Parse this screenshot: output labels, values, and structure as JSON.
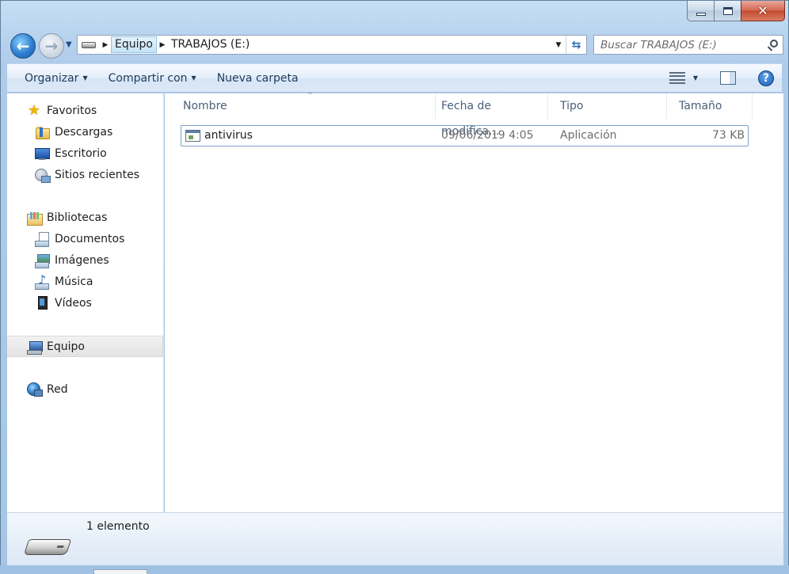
{
  "window": {
    "close_label": "✕"
  },
  "navigation": {
    "back_glyph": "←",
    "forward_glyph": "→",
    "breadcrumb": [
      "Equipo",
      "TRABAJOS (E:)"
    ],
    "search_placeholder": "Buscar TRABAJOS (E:)"
  },
  "toolbar": {
    "organize": "Organizar",
    "share": "Compartir con",
    "new_folder": "Nueva carpeta",
    "help": "?"
  },
  "sidebar": {
    "favorites": {
      "label": "Favoritos",
      "items": [
        "Descargas",
        "Escritorio",
        "Sitios recientes"
      ]
    },
    "libraries": {
      "label": "Bibliotecas",
      "items": [
        "Documentos",
        "Imágenes",
        "Música",
        "Vídeos"
      ]
    },
    "computer": "Equipo",
    "network": "Red"
  },
  "files": {
    "columns": [
      "Nombre",
      "Fecha de modifica...",
      "Tipo",
      "Tamaño"
    ],
    "rows": [
      {
        "name": "antivirus",
        "date": "09/06/2019 4:05",
        "type": "Aplicación",
        "size": "73 KB"
      }
    ]
  },
  "details": {
    "item_count": "1 elemento"
  },
  "colors": {
    "frame": "#b9d4ef",
    "close_button": "#c24a2f",
    "selection_border": "#7da2ce"
  }
}
